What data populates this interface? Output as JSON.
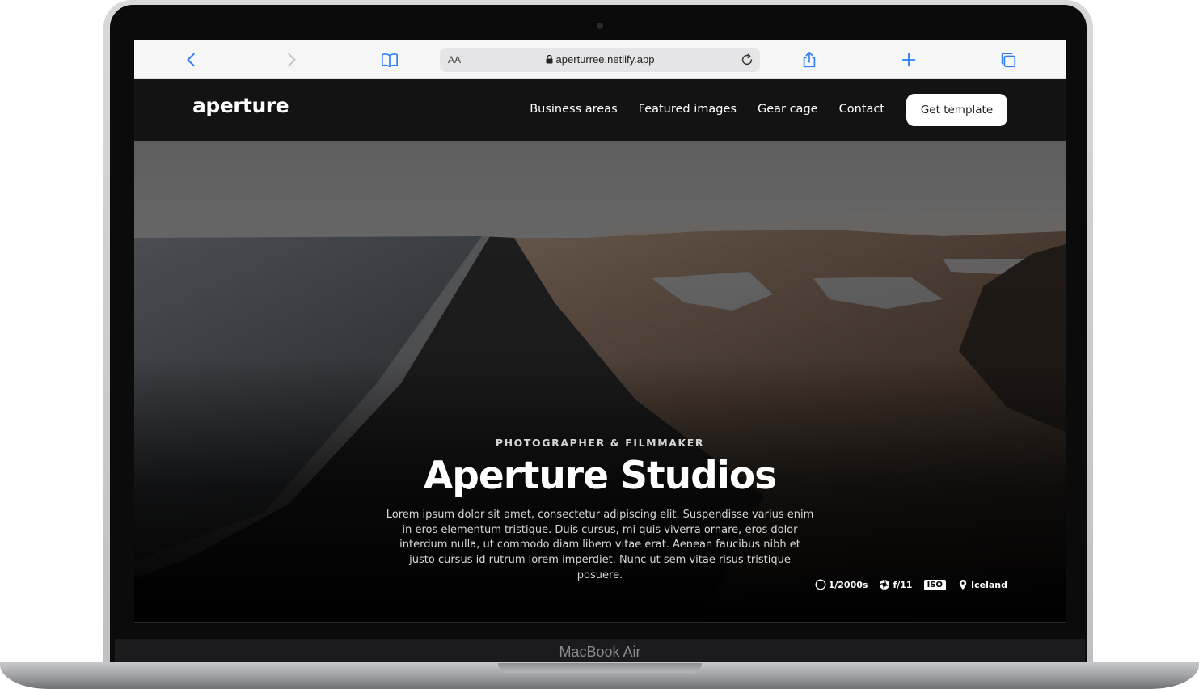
{
  "device": {
    "label": "MacBook Air"
  },
  "browser": {
    "aa_label": "AA",
    "url": "aperturree.netlify.app",
    "icons": [
      "chevron-left-icon",
      "chevron-right-icon",
      "book-icon",
      "lock-icon",
      "reload-icon",
      "share-icon",
      "plus-icon",
      "tabs-icon"
    ]
  },
  "site": {
    "logo": "aperture",
    "nav": [
      {
        "label": "Business areas"
      },
      {
        "label": "Featured images"
      },
      {
        "label": "Gear cage"
      },
      {
        "label": "Contact"
      }
    ],
    "cta": "Get template"
  },
  "hero": {
    "eyebrow": "PHOTOGRAPHER & FILMMAKER",
    "title": "Aperture Studios",
    "body": "Lorem ipsum dolor sit amet, consectetur adipiscing elit. Suspendisse varius enim in eros elementum tristique. Duis cursus, mi quis viverra ornare, eros dolor interdum nulla, ut commodo diam libero vitae erat. Aenean faucibus nibh et justo cursus id rutrum lorem imperdiet. Nunc ut sem vitae risus tristique posuere.",
    "meta": {
      "shutter": "1/2000s",
      "aperture": "f/11",
      "iso": "ISO",
      "location": "Iceland"
    }
  },
  "colors": {
    "nav_bg": "#131313",
    "accent_link": "#2f7cf6",
    "cta_bg": "#ffffff"
  }
}
